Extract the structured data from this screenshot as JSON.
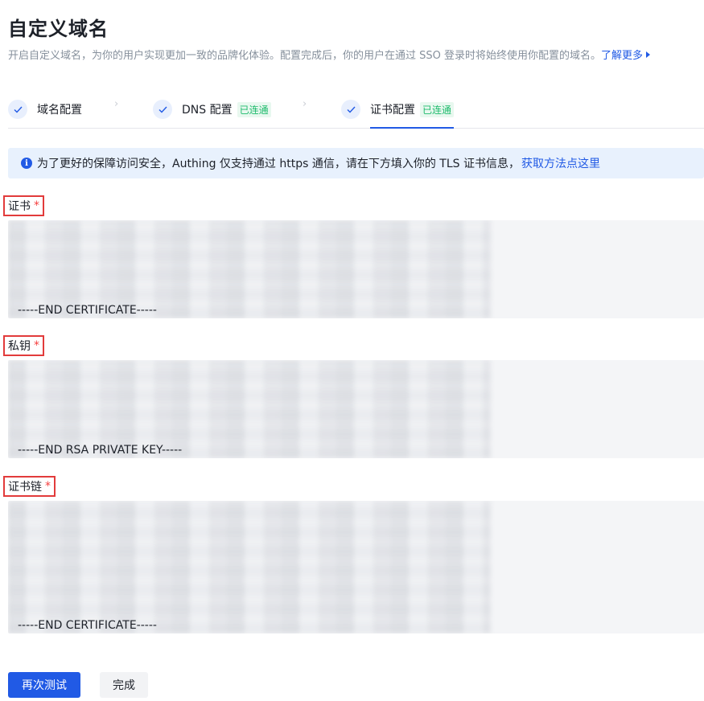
{
  "header": {
    "title": "自定义域名",
    "description": "开启自定义域名，为你的用户实现更加一致的品牌化体验。配置完成后，你的用户在通过 SSO 登录时将始终使用你配置的域名。",
    "learn_more": "了解更多"
  },
  "steps": [
    {
      "label": "域名配置",
      "badge": ""
    },
    {
      "label": "DNS 配置",
      "badge": "已连通"
    },
    {
      "label": "证书配置",
      "badge": "已连通"
    }
  ],
  "alert": {
    "text": "为了更好的保障访问安全，Authing 仅支持通过 https 通信，请在下方填入你的 TLS 证书信息，",
    "link": "获取方法点这里"
  },
  "fields": {
    "certificate": {
      "label": "证书",
      "required_mark": "*",
      "end_text": "-----END CERTIFICATE-----"
    },
    "private_key": {
      "label": "私钥",
      "required_mark": "*",
      "end_text": "-----END RSA PRIVATE KEY-----"
    },
    "chain": {
      "label": "证书链",
      "required_mark": "*",
      "end_text": "-----END CERTIFICATE-----"
    }
  },
  "actions": {
    "retest": "再次测试",
    "done": "完成"
  },
  "colors": {
    "primary": "#215ae5",
    "success": "#1ebb6c",
    "required": "#f53f3f",
    "highlight_box": "#e23b3b"
  }
}
